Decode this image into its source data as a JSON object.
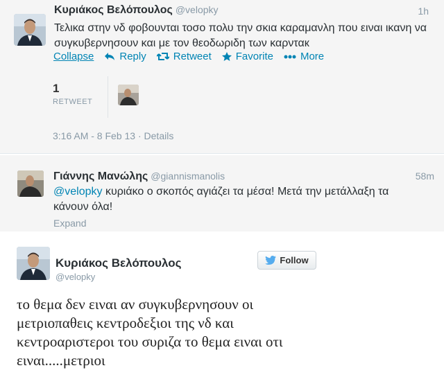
{
  "tweet": {
    "author_name": "Κυριάκος Βελόπουλος",
    "author_handle": "@velopky",
    "time": "1h",
    "text": "Τελικα στην νδ φοβουνται τοσο πολυ την σκια καραμανλη που ειναι ικανη να συγκυβερνησουν και με τον θεοδωριδη των καρνταк",
    "actions": {
      "collapse": "Collapse",
      "reply": "Reply",
      "retweet": "Retweet",
      "favorite": "Favorite",
      "more": "More"
    },
    "stats": {
      "retweet_count": "1",
      "retweet_label": "RETWEET"
    },
    "meta": {
      "timestamp": "3:16 AM - 8 Feb 13",
      "separator": "·",
      "details": "Details"
    },
    "colors": {
      "link": "#0084b4",
      "muted": "#8899a6",
      "background": "#f5f5f5"
    }
  },
  "reply": {
    "author_name": "Γιάννης Μανώλης",
    "author_handle": "@giannismanolis",
    "time": "58m",
    "mention": "@velopky",
    "text": " κυριάκο ο σκοπός αγιάζει τα μέσα! Μετά την μετάλλαξη τα κάνουν όλα!",
    "expand": "Expand"
  },
  "profile_card": {
    "name": "Κυριάκος Βελόπουλος",
    "handle": "@velopky",
    "follow_label": "Follow",
    "text": "το θεμα δεν ειναι αν συγκυβερνησουν οι μετριοπαθεις κεντροδεξιοι της νδ και κεντροαριστεροι του συριζα το θεμα ειναι οτι ειναι.....μετριοι"
  }
}
